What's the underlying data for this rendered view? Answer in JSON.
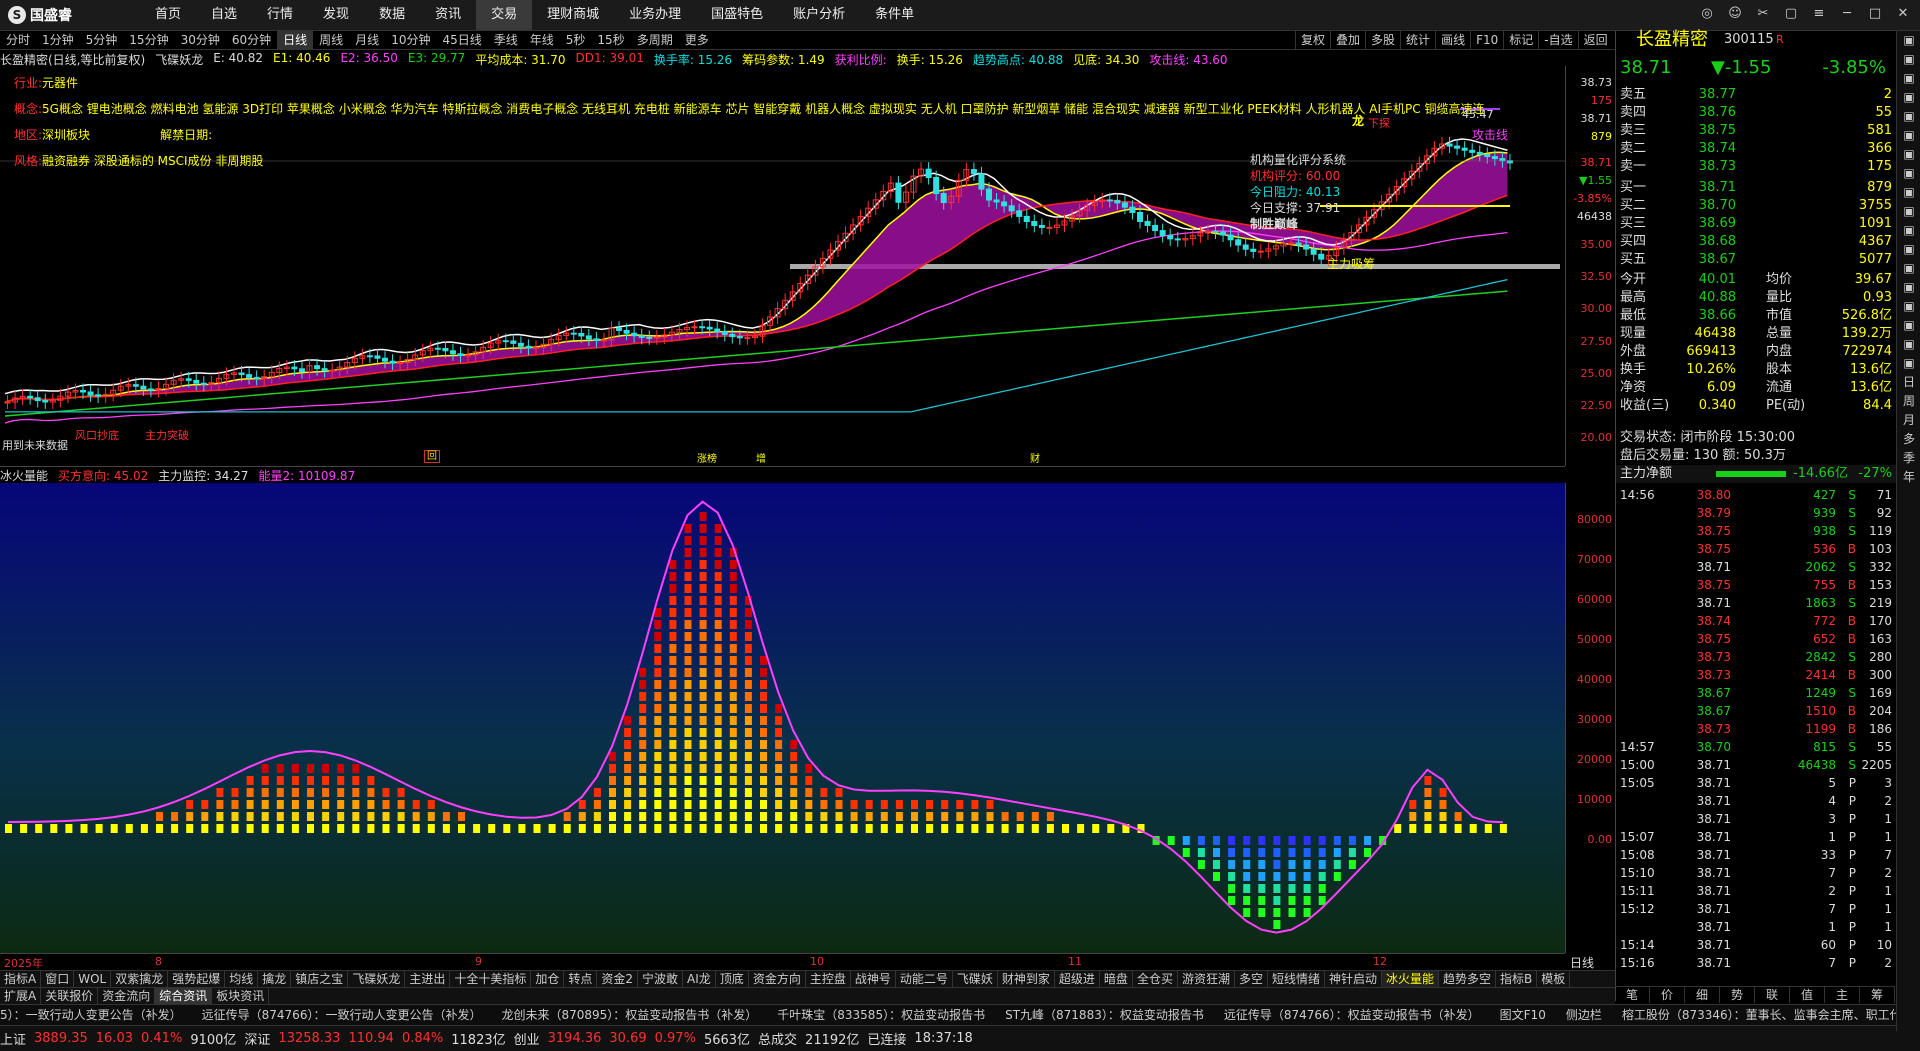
{
  "app": {
    "name": "国盛睿"
  },
  "topmenu": [
    "首页",
    "自选",
    "行情",
    "发现",
    "数据",
    "资讯",
    "交易",
    "理财商城",
    "业务办理",
    "国盛特色",
    "账户分析",
    "条件单"
  ],
  "topmenu_active": "交易",
  "periods": [
    "分时",
    "1分钟",
    "5分钟",
    "15分钟",
    "30分钟",
    "60分钟",
    "日线",
    "周线",
    "月线",
    "10分钟",
    "45日线",
    "季线",
    "年线",
    "5秒",
    "15秒",
    "多周期",
    "更多"
  ],
  "period_active": "日线",
  "tools": [
    "复权",
    "叠加",
    "多股",
    "统计",
    "画线",
    "F10",
    "标记",
    "-自选",
    "返回"
  ],
  "ind_header": [
    {
      "t": "长盈精密(日线,等比前复权)",
      "c": "white"
    },
    {
      "t": "飞碟妖龙",
      "c": "white"
    },
    {
      "t": "E: 40.82",
      "c": "white"
    },
    {
      "t": "E1: 40.46",
      "c": "yellow"
    },
    {
      "t": "E2: 36.50",
      "c": "mag"
    },
    {
      "t": "E3: 29.77",
      "c": "green"
    },
    {
      "t": "平均成本: 31.70",
      "c": "yellow"
    },
    {
      "t": "DD1: 39.01",
      "c": "red"
    },
    {
      "t": "换手率: 15.26",
      "c": "cyan"
    },
    {
      "t": "筹码参数: 1.49",
      "c": "yellow"
    },
    {
      "t": "获利比例:",
      "c": "mag"
    },
    {
      "t": "换手: 15.26",
      "c": "yellow"
    },
    {
      "t": "趋势高点: 40.88",
      "c": "cyan"
    },
    {
      "t": "见底: 34.30",
      "c": "yellow"
    },
    {
      "t": "攻击线: 43.60",
      "c": "mag"
    }
  ],
  "info": {
    "industry_label": "行业:",
    "industry": "元器件",
    "concept_label": "概念:",
    "concept": "5G概念 锂电池概念 燃料电池 氢能源 3D打印 苹果概念 小米概念 华为汽车 特斯拉概念 消费电子概念 无线耳机 充电桩 新能源车 芯片 智能穿戴 机器人概念 虚拟现实 无人机 口罩防护 新型烟草 储能 混合现实 减速器 新型工业化 PEEK材料 人形机器人 AI手机PC 铜缆高速连",
    "region_label": "地区:",
    "region": "深圳板块",
    "unlock_label": "解禁日期:",
    "style_label": "风格:",
    "style": "融资融券 深股通标的 MSCI成份 非周期股"
  },
  "annotations": {
    "rating_title": "机构量化评分系统",
    "rating_score": "机构评分: 60.00",
    "resistance": "今日阻力: 40.13",
    "support": "今日支撑: 37.91",
    "win": "制胜巅峰",
    "main_absorb": "主力吸筹",
    "attack_line": "攻击线",
    "high_label": "45.47",
    "low_label": "用到未来数据",
    "window": "风口抄底",
    "breakout": "主力突破",
    "dragon": "龙",
    "down": "下探"
  },
  "price_axis": [
    "38.73",
    "175",
    "38.71",
    "879",
    "38.71",
    "▼1.55",
    "-3.85%",
    "46438",
    "35.00",
    "32.50",
    "30.00",
    "27.50",
    "25.00",
    "22.50",
    "20.00"
  ],
  "price_markers": [
    "回",
    "涨榜",
    "增",
    "财"
  ],
  "lower_header": [
    {
      "t": "冰火量能",
      "c": "white"
    },
    {
      "t": "买方意向: 45.02",
      "c": "red"
    },
    {
      "t": "主力监控: 34.27",
      "c": "white"
    },
    {
      "t": "能量2: 10109.87",
      "c": "mag"
    }
  ],
  "lower_axis": [
    "80000",
    "70000",
    "60000",
    "50000",
    "40000",
    "30000",
    "20000",
    "10000",
    "0.00"
  ],
  "dates": [
    "2025年",
    "8",
    "9",
    "10",
    "11",
    "12"
  ],
  "date_right": "日线",
  "btabs1": [
    "指标A",
    "窗口",
    "WOL",
    "双紫擒龙",
    "强势起爆",
    "均线",
    "擒龙",
    "镇店之宝",
    "飞碟妖龙",
    "主进出",
    "十全十美指标",
    "加仓",
    "转点",
    "资金2",
    "宁波敢",
    "AI龙",
    "顶底",
    "资金方向",
    "主控盘",
    "战神号",
    "动能二号",
    "飞碟妖",
    "财神到家",
    "超级进",
    "暗盘",
    "全仓买",
    "游资狂潮",
    "多空",
    "短线情绪",
    "神针启动",
    "冰火量能",
    "趋势多空",
    "指标B",
    "模板"
  ],
  "btabs1_active": "冰火量能",
  "btabs2": [
    "扩展A",
    "关联报价",
    "资金流向",
    "综合资讯",
    "板块资讯"
  ],
  "btabs2_active": "综合资讯",
  "ticker": [
    "5）：一致行动人变更公告（补发）",
    "远征传导（874766）：一致行动人变更公告（补发）",
    "龙创未来（870895）：权益变动报告书（补发）",
    "千叶珠宝（833585）：权益变动报告书",
    "ST九峰（871883）：权益变动报告书",
    "远征传导（874766）：权益变动报告书（补发）",
    "图文F10",
    "侧边栏",
    "榕工股份（873346）：董事长、监事会主席、职工代表"
  ],
  "status": [
    {
      "t": "上证",
      "c": "white"
    },
    {
      "t": "3889.35",
      "c": "red"
    },
    {
      "t": "16.03",
      "c": "red"
    },
    {
      "t": "0.41%",
      "c": "red"
    },
    {
      "t": "9100亿",
      "c": "white"
    },
    {
      "t": "深证",
      "c": "white"
    },
    {
      "t": "13258.33",
      "c": "red"
    },
    {
      "t": "110.94",
      "c": "red"
    },
    {
      "t": "0.84%",
      "c": "red"
    },
    {
      "t": "11823亿",
      "c": "white"
    },
    {
      "t": "创业",
      "c": "white"
    },
    {
      "t": "3194.36",
      "c": "red"
    },
    {
      "t": "30.69",
      "c": "red"
    },
    {
      "t": "0.97%",
      "c": "red"
    },
    {
      "t": "5663亿",
      "c": "white"
    },
    {
      "t": "总成交",
      "c": "white"
    },
    {
      "t": "21192亿",
      "c": "white"
    },
    {
      "t": "已连接",
      "c": "white"
    },
    {
      "t": "18:37:18",
      "c": "white"
    }
  ],
  "quote": {
    "name": "长盈精密",
    "code": "300115",
    "tag": "R",
    "price": "38.71",
    "change": "▼-1.55",
    "pct": "-3.85%",
    "asks": [
      [
        "卖五",
        "38.77",
        "2"
      ],
      [
        "卖四",
        "38.76",
        "55"
      ],
      [
        "卖三",
        "38.75",
        "581"
      ],
      [
        "卖二",
        "38.74",
        "366"
      ],
      [
        "卖一",
        "38.73",
        "175"
      ]
    ],
    "bids": [
      [
        "买一",
        "38.71",
        "879"
      ],
      [
        "买二",
        "38.70",
        "3755"
      ],
      [
        "买三",
        "38.69",
        "1091"
      ],
      [
        "买四",
        "38.68",
        "4367"
      ],
      [
        "买五",
        "38.67",
        "5077"
      ]
    ],
    "stats": [
      [
        "今开",
        "40.01",
        "均价",
        "39.67"
      ],
      [
        "最高",
        "40.88",
        "量比",
        "0.93"
      ],
      [
        "最低",
        "38.66",
        "市值",
        "526.8亿"
      ],
      [
        "现量",
        "46438",
        "总量",
        "139.2万"
      ],
      [
        "外盘",
        "669413",
        "内盘",
        "722974"
      ],
      [
        "换手",
        "10.26%",
        "股本",
        "13.6亿"
      ],
      [
        "净资",
        "6.09",
        "流通",
        "13.6亿"
      ],
      [
        "收益(三)",
        "0.340",
        "PE(动)",
        "84.4"
      ]
    ],
    "trade_status": "交易状态: 闭市阶段 15:30:00",
    "after_hours": "盘后交易量: 130  额: 50.3万",
    "net_label": "主力净额",
    "net_value": "-14.66亿",
    "net_pct": "-27%",
    "trades": [
      [
        "14:56",
        "38.80",
        "427",
        "S",
        "71"
      ],
      [
        "",
        "38.79",
        "939",
        "S",
        "92"
      ],
      [
        "",
        "38.75",
        "938",
        "S",
        "119"
      ],
      [
        "",
        "38.75",
        "536",
        "B",
        "103"
      ],
      [
        "",
        "38.71",
        "2062",
        "S",
        "332"
      ],
      [
        "",
        "38.75",
        "755",
        "B",
        "153"
      ],
      [
        "",
        "38.71",
        "1863",
        "S",
        "219"
      ],
      [
        "",
        "38.74",
        "772",
        "B",
        "170"
      ],
      [
        "",
        "38.75",
        "652",
        "B",
        "163"
      ],
      [
        "",
        "38.73",
        "2842",
        "S",
        "280"
      ],
      [
        "",
        "38.73",
        "2414",
        "B",
        "300"
      ],
      [
        "",
        "38.67",
        "1249",
        "S",
        "169"
      ],
      [
        "",
        "38.67",
        "1510",
        "B",
        "204"
      ],
      [
        "",
        "38.73",
        "1199",
        "B",
        "186"
      ],
      [
        "14:57",
        "38.70",
        "815",
        "S",
        "55"
      ],
      [
        "15:00",
        "38.71",
        "46438",
        "S",
        "2205"
      ],
      [
        "15:05",
        "38.71",
        "5",
        "P",
        "3"
      ],
      [
        "",
        "38.71",
        "4",
        "P",
        "2"
      ],
      [
        "",
        "38.71",
        "3",
        "P",
        "1"
      ],
      [
        "15:07",
        "38.71",
        "1",
        "P",
        "1"
      ],
      [
        "15:08",
        "38.71",
        "33",
        "P",
        "7"
      ],
      [
        "15:10",
        "38.71",
        "7",
        "P",
        "2"
      ],
      [
        "15:11",
        "38.71",
        "2",
        "P",
        "1"
      ],
      [
        "15:12",
        "38.71",
        "7",
        "P",
        "1"
      ],
      [
        "",
        "38.71",
        "1",
        "P",
        "1"
      ],
      [
        "15:14",
        "38.71",
        "60",
        "P",
        "10"
      ],
      [
        "15:16",
        "38.71",
        "7",
        "P",
        "2"
      ]
    ],
    "buttons": [
      "笔",
      "价",
      "细",
      "势",
      "联",
      "值",
      "主",
      "筹"
    ]
  },
  "sidebar": [
    "日",
    "周",
    "月",
    "多",
    "季",
    "年"
  ]
}
